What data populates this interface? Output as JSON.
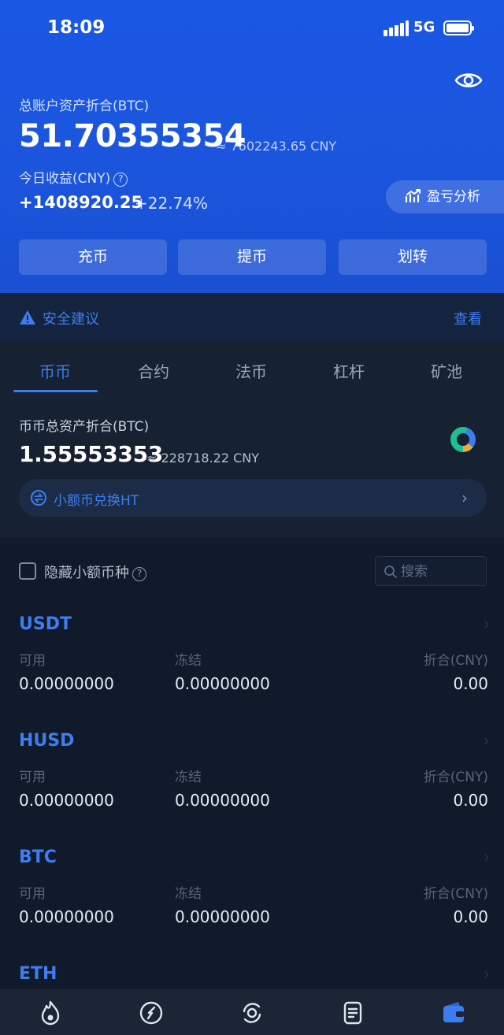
{
  "status_bar": {
    "time": "18:09",
    "network": "5G"
  },
  "header": {
    "total_label": "总账户资产折合(BTC)",
    "total_value": "51.70355354",
    "total_cny": "≈ 7602243.65 CNY",
    "today_label": "今日收益(CNY)",
    "today_value": "+1408920.25",
    "today_pct": "+22.74%",
    "pnl_button": "盈亏分析",
    "actions": [
      "充币",
      "提币",
      "划转"
    ]
  },
  "security": {
    "label": "安全建议",
    "link": "查看"
  },
  "tabs": [
    "币币",
    "合约",
    "法币",
    "杠杆",
    "矿池"
  ],
  "overview": {
    "label": "币币总资产折合(BTC)",
    "value": "1.55553353",
    "cny": "≈ 228718.22 CNY",
    "convert_label": "小额币兑换HT"
  },
  "list_controls": {
    "hide_small_label": "隐藏小额币种",
    "search_placeholder": "搜索"
  },
  "columns": {
    "available": "可用",
    "frozen": "冻结",
    "equiv": "折合(CNY)"
  },
  "assets": [
    {
      "name": "USDT",
      "available": "0.00000000",
      "frozen": "0.00000000",
      "equiv": "0.00"
    },
    {
      "name": "HUSD",
      "available": "0.00000000",
      "frozen": "0.00000000",
      "equiv": "0.00"
    },
    {
      "name": "BTC",
      "available": "0.00000000",
      "frozen": "0.00000000",
      "equiv": "0.00"
    },
    {
      "name": "ETH"
    }
  ],
  "bottom_nav": {
    "icons": [
      "flame-icon",
      "compass-icon",
      "exchange-icon",
      "document-icon",
      "wallet-icon"
    ],
    "active_index": 4
  },
  "colors": {
    "header_blue": "#1a57e3",
    "accent_blue": "#3e7df0",
    "background": "#111b2b"
  }
}
